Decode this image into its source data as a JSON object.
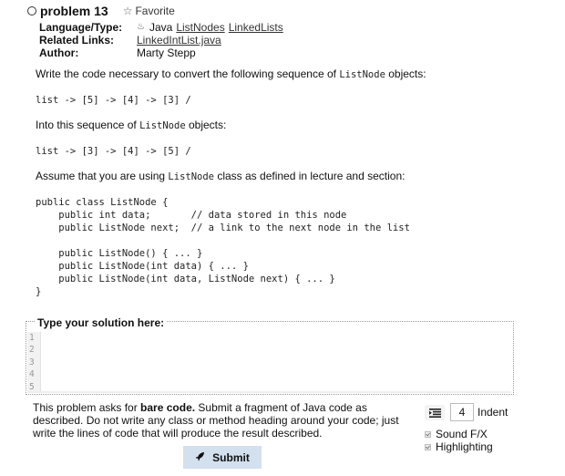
{
  "problem": {
    "title": "problem 13",
    "favorite_label": "Favorite",
    "star_icon": "star-outline-icon",
    "radio_icon": "radio-empty-icon"
  },
  "meta": {
    "language_label": "Language/Type:",
    "language_icon": "java-cup-icon",
    "language_value": "Java",
    "tags": [
      "ListNodes",
      "LinkedLists"
    ],
    "related_label": "Related Links:",
    "related_link": "LinkedIntList.java",
    "author_label": "Author:",
    "author_value": "Marty Stepp"
  },
  "description": {
    "p1_before": "Write the code necessary to convert the following sequence of ",
    "p1_code": "ListNode",
    "p1_after": " objects:",
    "seq1": "list -> [5] -> [4] -> [3] /",
    "p2_before": "Into this sequence of ",
    "p2_code": "ListNode",
    "p2_after": " objects:",
    "seq2": "list -> [3] -> [4] -> [5] /",
    "p3_before": "Assume that you are using ",
    "p3_code": "ListNode",
    "p3_after": " class as defined in lecture and section:",
    "class_code": "public class ListNode {\n    public int data;       // data stored in this node\n    public ListNode next;  // a link to the next node in the list\n\n    public ListNode() { ... }\n    public ListNode(int data) { ... }\n    public ListNode(int data, ListNode next) { ... }\n}"
  },
  "solution": {
    "legend": "Type your solution here:",
    "line_numbers": [
      "1",
      "2",
      "3",
      "4",
      "5"
    ],
    "value": ""
  },
  "notice": {
    "before": "This problem asks for ",
    "bold": "bare code.",
    "after": " Submit a fragment of Java code as described. Do not write any class or method heading around your code; just write the lines of code that will produce the result described."
  },
  "submit": {
    "label": "Submit",
    "icon": "rocket-icon"
  },
  "options": {
    "indent_icon": "indent-icon",
    "indent_value": "4",
    "indent_label": "Indent",
    "sound_label": "Sound F/X",
    "sound_checked": true,
    "highlighting_label": "Highlighting",
    "highlighting_checked": true
  }
}
